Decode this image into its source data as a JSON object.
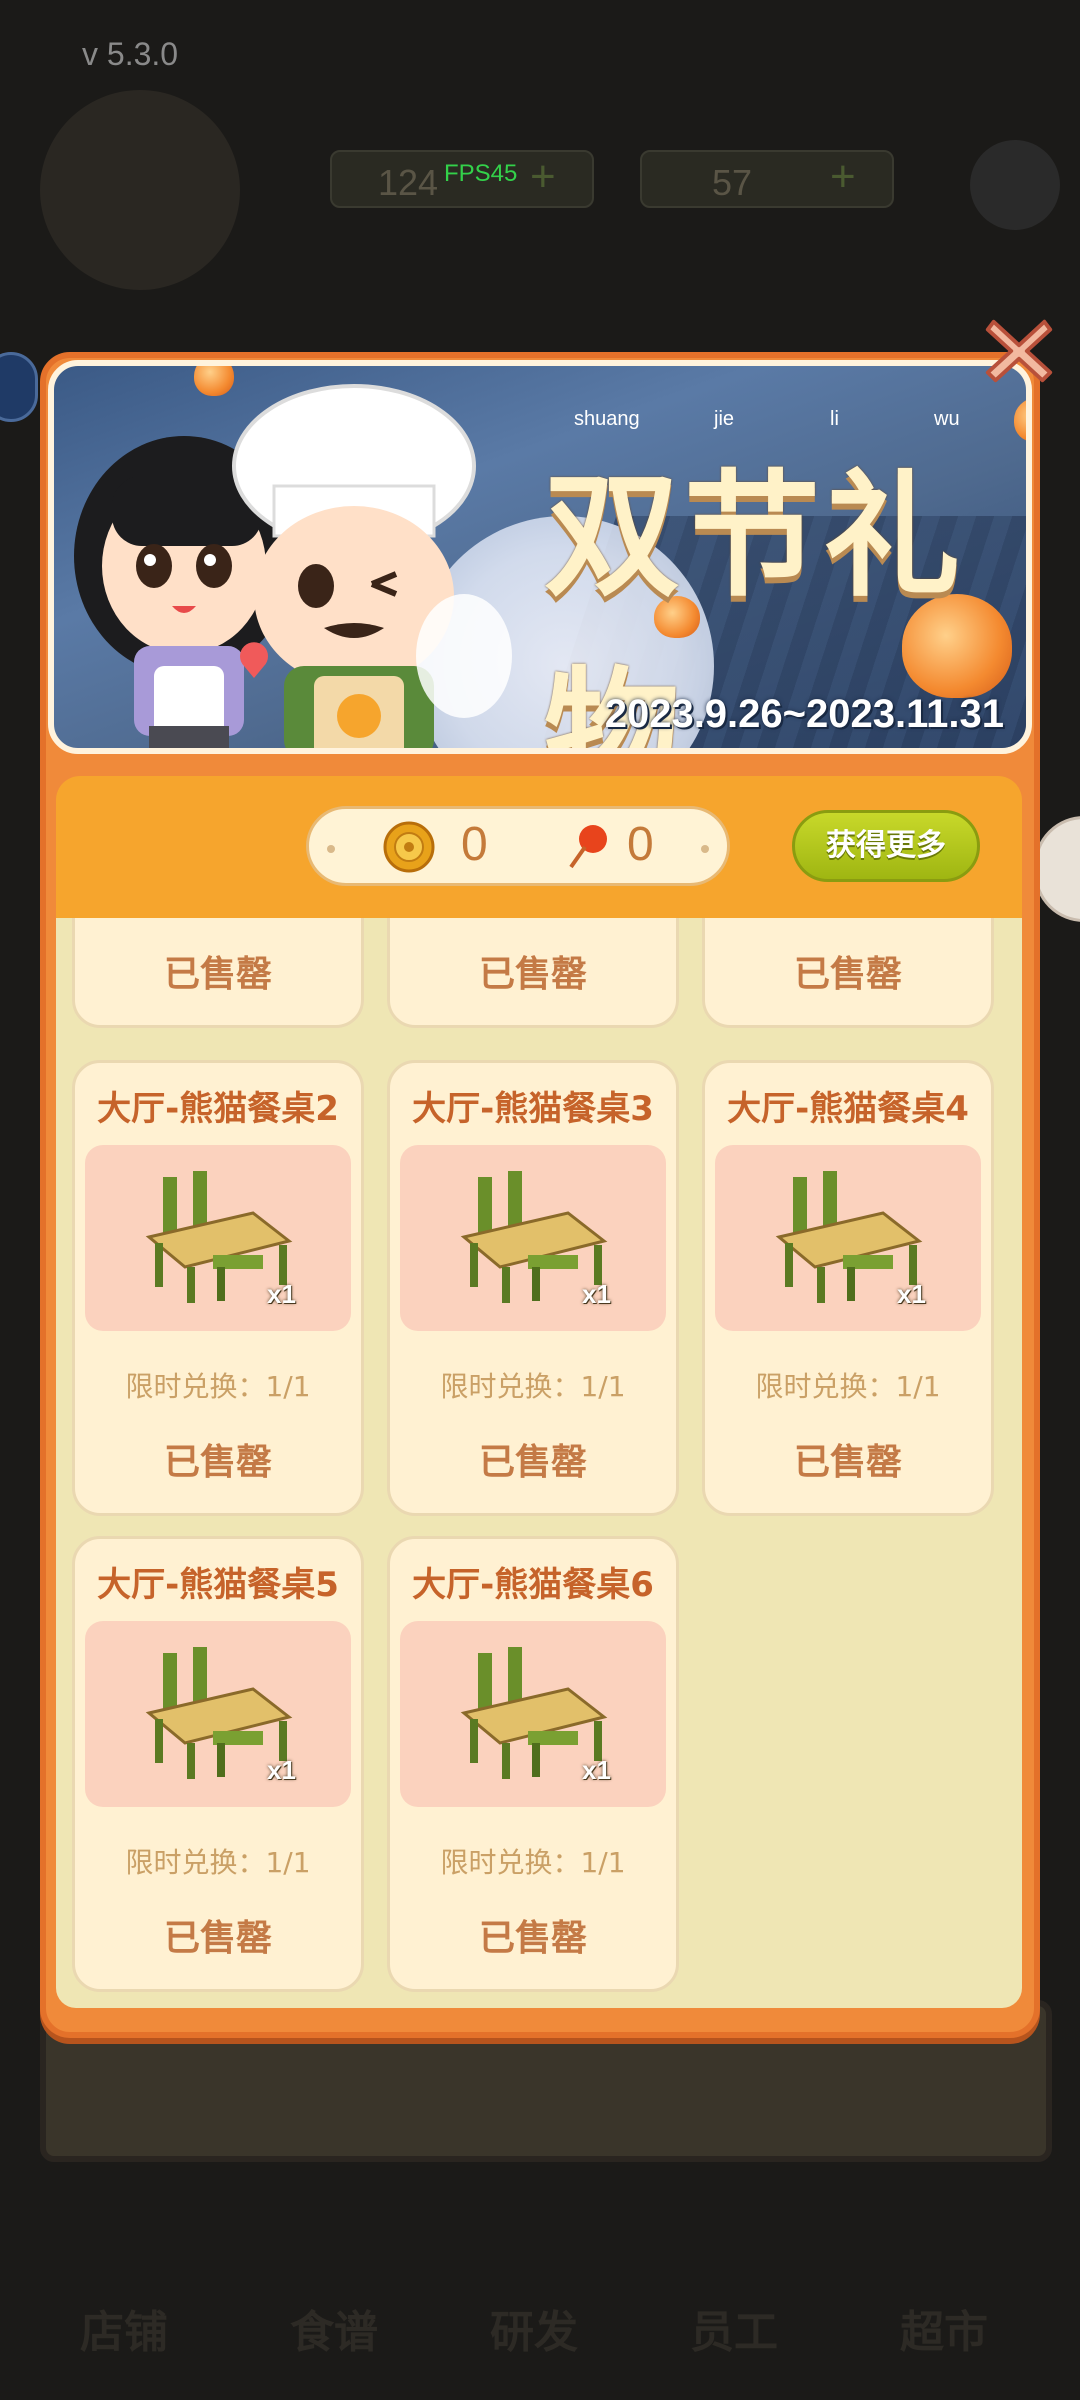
{
  "app": {
    "version": "v  5.3.0",
    "fps": "FPS45"
  },
  "background": {
    "counter_left": "124",
    "counter_right": "57",
    "nav": [
      "店铺",
      "食谱",
      "研发",
      "员工",
      "超市"
    ]
  },
  "banner": {
    "title": "双节礼物",
    "pinyin": [
      "shuang",
      "jie",
      "li",
      "wu"
    ],
    "date_range": "2023.9.26~2023.11.31"
  },
  "currency": {
    "mooncake_count": "0",
    "lantern_count": "0",
    "get_more_label": "获得更多"
  },
  "shop": {
    "partial_row_status": [
      "已售罄",
      "已售罄",
      "已售罄"
    ],
    "items": [
      {
        "name": "大厅-熊猫餐桌2",
        "qty": "x1",
        "limit": "限时兑换：1/1",
        "status": "已售罄"
      },
      {
        "name": "大厅-熊猫餐桌3",
        "qty": "x1",
        "limit": "限时兑换：1/1",
        "status": "已售罄"
      },
      {
        "name": "大厅-熊猫餐桌4",
        "qty": "x1",
        "limit": "限时兑换：1/1",
        "status": "已售罄"
      },
      {
        "name": "大厅-熊猫餐桌5",
        "qty": "x1",
        "limit": "限时兑换：1/1",
        "status": "已售罄"
      },
      {
        "name": "大厅-熊猫餐桌6",
        "qty": "x1",
        "limit": "限时兑换：1/1",
        "status": "已售罄"
      }
    ]
  },
  "colors": {
    "modal_orange": "#f08a3a",
    "bar_orange": "#f6a52d",
    "button_green": "#b4c81e",
    "card_bg": "#fff1d2",
    "title_brown": "#c6632a"
  },
  "icons": {
    "close": "close-icon",
    "mooncake": "mooncake-icon",
    "lantern": "lantern-icon",
    "table": "panda-table-icon"
  }
}
